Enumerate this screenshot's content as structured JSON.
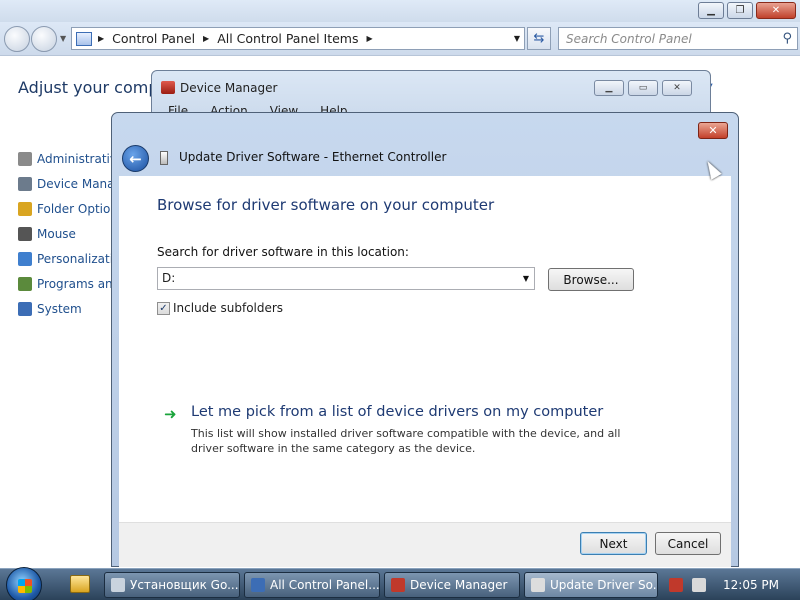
{
  "control_panel": {
    "breadcrumb": [
      "Control Panel",
      "All Control Panel Items"
    ],
    "search_placeholder": "Search Control Panel",
    "heading": "Adjust your compu",
    "items": [
      {
        "label": "Administrative",
        "color": "#8a8a8a"
      },
      {
        "label": "Device Manag",
        "color": "#6c7b8c"
      },
      {
        "label": "Folder Option",
        "color": "#d9a521"
      },
      {
        "label": "Mouse",
        "color": "#555555"
      },
      {
        "label": "Personalizatio",
        "color": "#3f7fce"
      },
      {
        "label": "Programs and",
        "color": "#5b8a3c"
      },
      {
        "label": "System",
        "color": "#3c6db5"
      }
    ]
  },
  "device_manager": {
    "title": "Device Manager",
    "menu": [
      "File",
      "Action",
      "View",
      "Help"
    ]
  },
  "dialog": {
    "title": "Update Driver Software - Ethernet Controller",
    "heading": "Browse for driver software on your computer",
    "search_label": "Search for driver software in this location:",
    "path_value": "D:",
    "browse_label": "Browse...",
    "include_subfolders_label": "Include subfolders",
    "include_subfolders_checked": "✓",
    "pick_link_title": "Let me pick from a list of device drivers on my computer",
    "pick_link_desc": "This list will show installed driver software compatible with the device, and all driver software in the same category as the device.",
    "next_label": "Next",
    "cancel_label": "Cancel"
  },
  "taskbar": {
    "buttons": [
      {
        "label": "Установщик Go...",
        "icon_color": "#c9d3de"
      },
      {
        "label": "All Control Panel...",
        "icon_color": "#3c6db5"
      },
      {
        "label": "Device Manager",
        "icon_color": "#c0392b"
      },
      {
        "label": "Update Driver So...",
        "icon_color": "#dddddd"
      }
    ],
    "clock": "12:05 PM"
  }
}
